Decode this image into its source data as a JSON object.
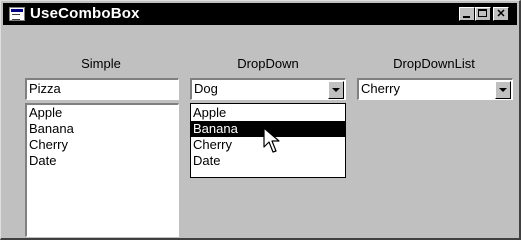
{
  "window": {
    "title": "UseComboBox"
  },
  "simple": {
    "label": "Simple",
    "value": "Pizza",
    "items": [
      "Apple",
      "Banana",
      "Cherry",
      "Date"
    ]
  },
  "dropdown": {
    "label": "DropDown",
    "value": "Dog",
    "items": [
      "Apple",
      "Banana",
      "Cherry",
      "Date"
    ],
    "highlighted": "Banana"
  },
  "dropdownlist": {
    "label": "DropDownList",
    "value": "Cherry"
  }
}
